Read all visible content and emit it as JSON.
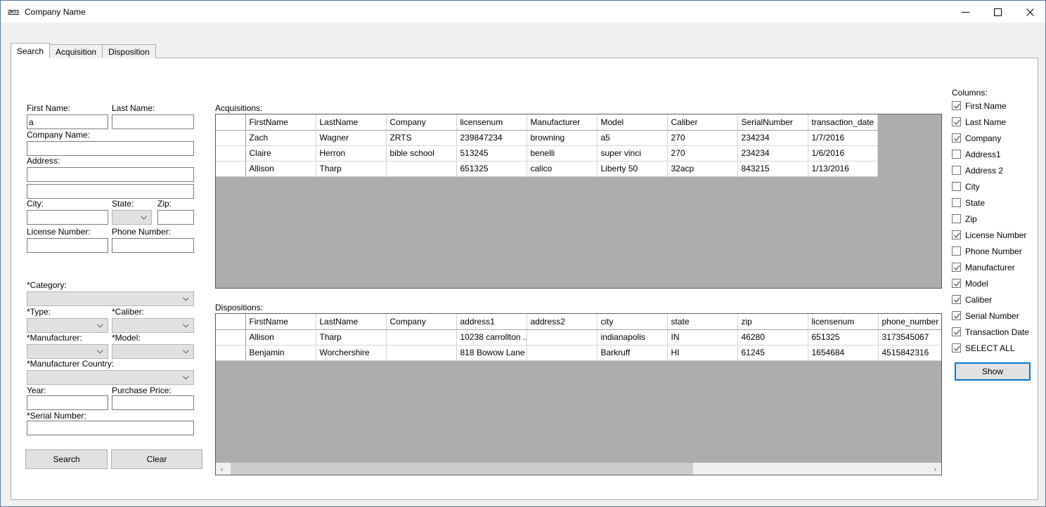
{
  "window": {
    "title": "Company Name",
    "icon_text": "ZRTS",
    "minimize_label": "Minimize",
    "maximize_label": "Maximize",
    "close_label": "Close"
  },
  "tabs": [
    {
      "label": "Search",
      "active": true
    },
    {
      "label": "Acquisition",
      "active": false
    },
    {
      "label": "Disposition",
      "active": false
    }
  ],
  "search_form": {
    "first_name_label": "First Name:",
    "first_name_value": "a",
    "last_name_label": "Last Name:",
    "last_name_value": "",
    "company_name_label": "Company Name:",
    "company_name_value": "",
    "address_label": "Address:",
    "address1_value": "",
    "address2_value": "",
    "city_label": "City:",
    "city_value": "",
    "state_label": "State:",
    "state_value": "",
    "zip_label": "Zip:",
    "zip_value": "",
    "license_number_label": "License Number:",
    "license_number_value": "",
    "phone_number_label": "Phone Number:",
    "phone_number_value": "",
    "category_label": "*Category:",
    "category_value": "",
    "type_label": "*Type:",
    "type_value": "",
    "caliber_label": "*Caliber:",
    "caliber_value": "",
    "manufacturer_label": "*Manufacturer:",
    "manufacturer_value": "",
    "model_label": "*Model:",
    "model_value": "",
    "manufacturer_country_label": "*Manufacturer Country:",
    "manufacturer_country_value": "",
    "year_label": "Year:",
    "year_value": "",
    "purchase_price_label": "Purchase Price:",
    "purchase_price_value": "",
    "serial_number_label": "*Serial Number:",
    "serial_number_value": "",
    "search_button": "Search",
    "clear_button": "Clear"
  },
  "acquisitions": {
    "caption": "Acquisitions:",
    "columns": [
      "FirstName",
      "LastName",
      "Company",
      "licensenum",
      "Manufacturer",
      "Model",
      "Caliber",
      "SerialNumber",
      "transaction_date"
    ],
    "rows": [
      [
        "Zach",
        "Wagner",
        "ZRTS",
        "239847234",
        "browning",
        "a5",
        "270",
        "234234",
        "1/7/2016"
      ],
      [
        "Claire",
        "Herron",
        "bible school",
        "513245",
        "benelli",
        "super vinci",
        "270",
        "234234",
        "1/6/2016"
      ],
      [
        "Allison",
        "Tharp",
        "",
        "651325",
        "calico",
        "Liberty 50",
        "32acp",
        "843215",
        "1/13/2016"
      ]
    ]
  },
  "dispositions": {
    "caption": "Dispositions:",
    "columns": [
      "FirstName",
      "LastName",
      "Company",
      "address1",
      "address2",
      "city",
      "state",
      "zip",
      "licensenum",
      "phone_number"
    ],
    "rows": [
      [
        "Allison",
        "Tharp",
        "",
        "10238 carrollton ...",
        "",
        "indianapolis",
        "IN",
        "46280",
        "651325",
        "3173545067"
      ],
      [
        "Benjamin",
        "Worchershire",
        "",
        "818 Bowow Lane",
        "",
        "Barkruff",
        "HI",
        "61245",
        "1654684",
        "4515842316"
      ]
    ],
    "scroll_left_icon": "‹",
    "scroll_right_icon": "›"
  },
  "columns_panel": {
    "caption": "Columns:",
    "items": [
      {
        "label": "First Name",
        "checked": true
      },
      {
        "label": "Last Name",
        "checked": true
      },
      {
        "label": "Company",
        "checked": true
      },
      {
        "label": "Address1",
        "checked": false
      },
      {
        "label": "Address 2",
        "checked": false
      },
      {
        "label": "City",
        "checked": false
      },
      {
        "label": "State",
        "checked": false
      },
      {
        "label": "Zip",
        "checked": false
      },
      {
        "label": "License Number",
        "checked": true
      },
      {
        "label": "Phone Number",
        "checked": false
      },
      {
        "label": "Manufacturer",
        "checked": true
      },
      {
        "label": "Model",
        "checked": true
      },
      {
        "label": "Caliber",
        "checked": true
      },
      {
        "label": "Serial Number",
        "checked": true
      },
      {
        "label": "Transaction Date",
        "checked": true
      },
      {
        "label": "SELECT ALL",
        "checked": true
      }
    ],
    "show_button": "Show"
  },
  "colors": {
    "accent": "#0078d7",
    "window_border": "#5b7ca5",
    "grid_filler": "#adadad",
    "control_face": "#e1e1e1"
  }
}
